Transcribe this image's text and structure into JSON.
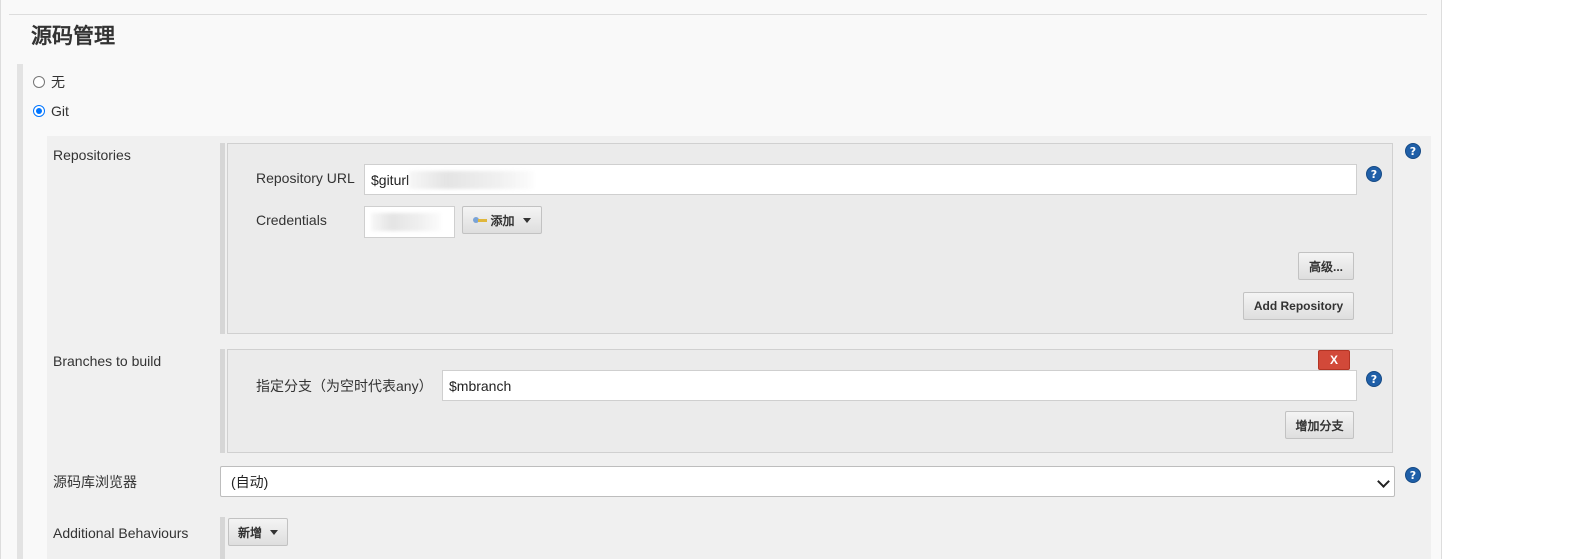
{
  "section": {
    "title": "源码管理"
  },
  "scm_options": [
    {
      "label": "无",
      "selected": false
    },
    {
      "label": "Git",
      "selected": true
    }
  ],
  "repositories": {
    "label": "Repositories",
    "url_label": "Repository URL",
    "url_value": "$giturl",
    "credentials_label": "Credentials",
    "add_button": "添加",
    "advanced_button": "高级...",
    "add_repo_button": "Add Repository"
  },
  "branches": {
    "label": "Branches to build",
    "branch_label": "指定分支（为空时代表any）",
    "branch_value": "$mbranch",
    "delete_button": "X",
    "add_branch_button": "增加分支"
  },
  "browser": {
    "label": "源码库浏览器",
    "selected": "(自动)"
  },
  "behaviours": {
    "label": "Additional Behaviours",
    "add_button": "新增"
  },
  "help_icon": "?",
  "colors": {
    "accent": "#1f5fa8",
    "delete": "#d24939",
    "radio": "#0075ff"
  }
}
